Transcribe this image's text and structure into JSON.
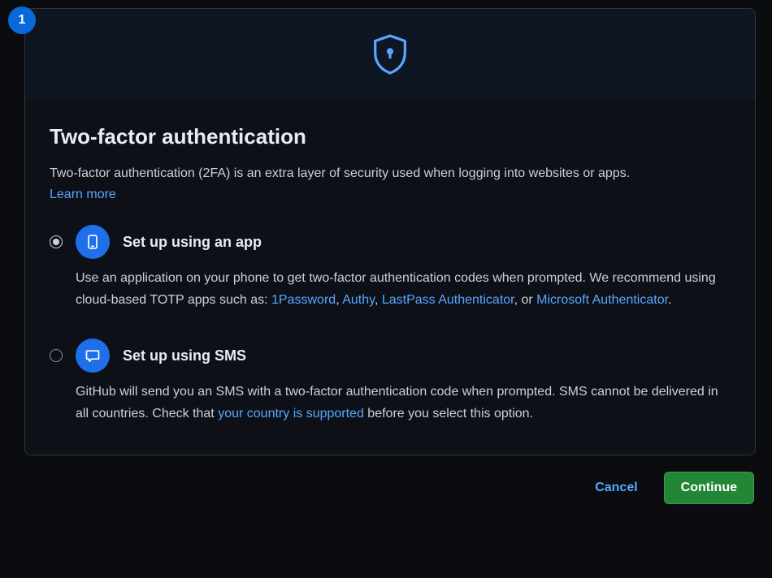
{
  "step_badge": "1",
  "title": "Two-factor authentication",
  "intro": "Two-factor authentication (2FA) is an extra layer of security used when logging into websites or apps.",
  "learn_more": "Learn more",
  "option_app": {
    "label": "Set up using an app",
    "desc_prefix": "Use an application on your phone to get two-factor authentication codes when prompted. We recommend using cloud-based TOTP apps such as: ",
    "link1": "1Password",
    "sep1": ", ",
    "link2": "Authy",
    "sep2": ", ",
    "link3": "LastPass Authenticator",
    "sep3": ", or ",
    "link4": "Microsoft Authenticator",
    "suffix": "."
  },
  "option_sms": {
    "label": "Set up using SMS",
    "desc_prefix": "GitHub will send you an SMS with a two-factor authentication code when prompted. SMS cannot be delivered in all countries. Check that ",
    "link1": "your country is supported",
    "suffix": " before you select this option."
  },
  "footer": {
    "cancel": "Cancel",
    "continue": "Continue"
  }
}
